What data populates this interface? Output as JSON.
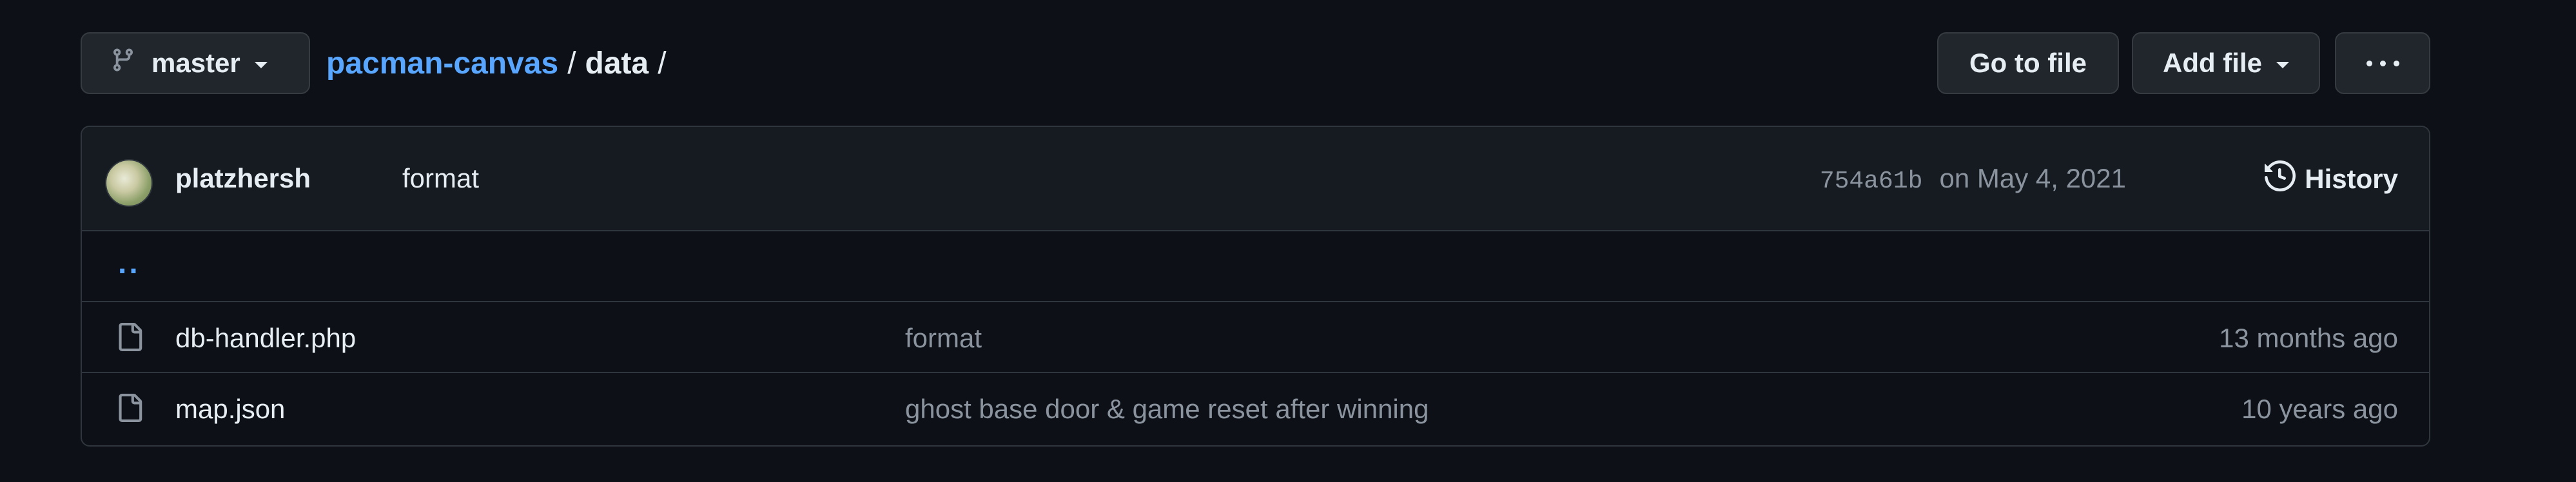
{
  "branch": {
    "name": "master",
    "icon": "git-branch-icon"
  },
  "breadcrumb": {
    "repo": "pacman-canvas",
    "separator": "/",
    "current": "data",
    "trailing": "/"
  },
  "actions": {
    "goto_file": "Go to file",
    "add_file": "Add file",
    "more": "more-options-icon"
  },
  "latest_commit": {
    "author": "platzhersh",
    "message": "format",
    "sha": "754a61b",
    "date": "on May 4, 2021",
    "history_label": "History"
  },
  "parent_dir": "..",
  "files": [
    {
      "name": "db-handler.php",
      "message": "format",
      "age": "13 months ago",
      "icon": "file-icon"
    },
    {
      "name": "map.json",
      "message": "ghost base door & game reset after winning",
      "age": "10 years ago",
      "icon": "file-icon"
    }
  ],
  "colors": {
    "background": "#0d1117",
    "link": "#58a6ff",
    "muted": "#8b949e",
    "border": "#30363d"
  }
}
